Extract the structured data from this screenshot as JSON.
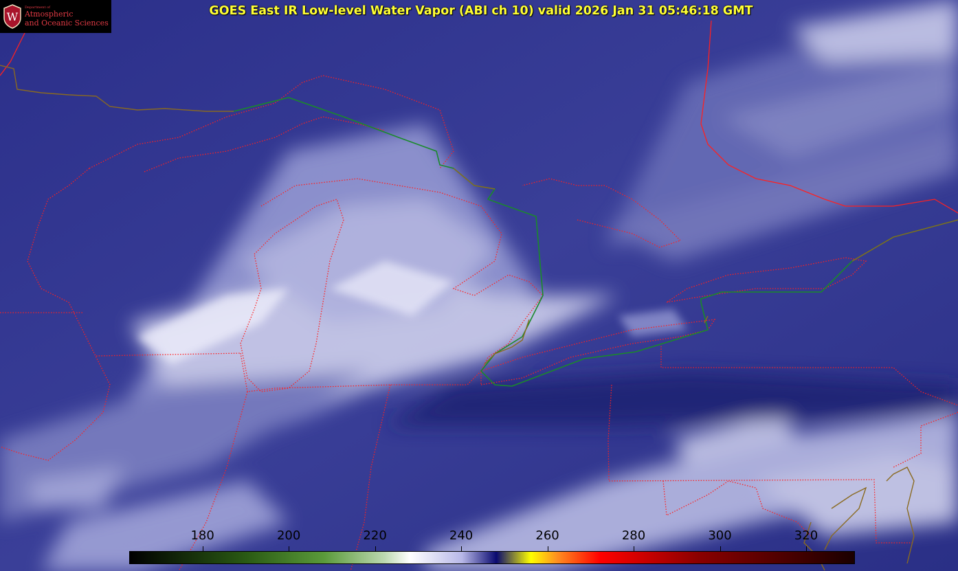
{
  "title": "GOES East IR Low-level Water Vapor (ABI ch 10) valid 2026 Jan 31 05:46:18 GMT",
  "logo": {
    "dept": "Department of",
    "line1": "Atmospheric",
    "line2": "and Oceanic Sciences",
    "crest_letter": "W",
    "crest_color": "#a8142b"
  },
  "colorbar": {
    "ticks": [
      "180",
      "200",
      "220",
      "240",
      "260",
      "280",
      "300",
      "320"
    ],
    "tick_values": [
      180,
      200,
      220,
      240,
      260,
      280,
      300,
      320
    ],
    "range": [
      163,
      331
    ],
    "stops": [
      {
        "v": 163,
        "c": "#000000"
      },
      {
        "v": 190,
        "c": "#2a5a14"
      },
      {
        "v": 208,
        "c": "#5a9a3a"
      },
      {
        "v": 222,
        "c": "#bcd8b0"
      },
      {
        "v": 228,
        "c": "#ffffff"
      },
      {
        "v": 240,
        "c": "#b8b8e8"
      },
      {
        "v": 248,
        "c": "#0a0a70"
      },
      {
        "v": 256,
        "c": "#ffff00"
      },
      {
        "v": 262,
        "c": "#ff9020"
      },
      {
        "v": 272,
        "c": "#ff0000"
      },
      {
        "v": 295,
        "c": "#8a0000"
      },
      {
        "v": 331,
        "c": "#1a0000"
      }
    ]
  },
  "colors": {
    "background": "#2a2f86",
    "borders": "#ff2020",
    "international_border": "#1a8a2a",
    "coastline": "#8a6a20",
    "title": "#ffff33"
  }
}
